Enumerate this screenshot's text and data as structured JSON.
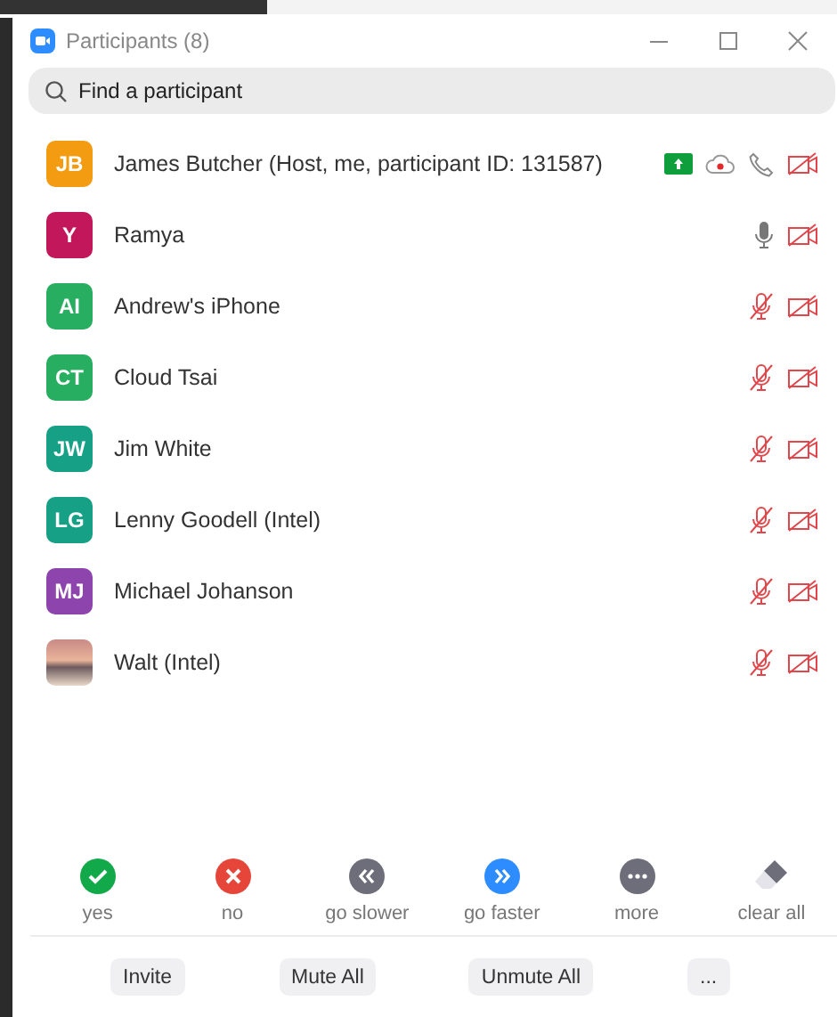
{
  "window": {
    "title": "Participants (8)"
  },
  "search": {
    "placeholder": "Find a participant"
  },
  "participants": [
    {
      "avatar": {
        "kind": "initials",
        "initials": "JB",
        "color": "#f39c12"
      },
      "name": "James Butcher (Host, me, participant ID: 131587)",
      "indicators": [
        {
          "kind": "screen-share"
        },
        {
          "kind": "recording"
        },
        {
          "kind": "phone"
        },
        {
          "kind": "video-off"
        }
      ]
    },
    {
      "avatar": {
        "kind": "initials",
        "initials": "Y",
        "color": "#c2185b"
      },
      "name": "Ramya",
      "indicators": [
        {
          "kind": "mic-on"
        },
        {
          "kind": "video-off"
        }
      ]
    },
    {
      "avatar": {
        "kind": "initials",
        "initials": "AI",
        "color": "#27ae60"
      },
      "name": "Andrew's iPhone",
      "indicators": [
        {
          "kind": "mic-muted"
        },
        {
          "kind": "video-off"
        }
      ]
    },
    {
      "avatar": {
        "kind": "initials",
        "initials": "CT",
        "color": "#27ae60"
      },
      "name": "Cloud Tsai",
      "indicators": [
        {
          "kind": "mic-muted"
        },
        {
          "kind": "video-off"
        }
      ]
    },
    {
      "avatar": {
        "kind": "initials",
        "initials": "JW",
        "color": "#16a085"
      },
      "name": "Jim White",
      "indicators": [
        {
          "kind": "mic-muted"
        },
        {
          "kind": "video-off"
        }
      ]
    },
    {
      "avatar": {
        "kind": "initials",
        "initials": "LG",
        "color": "#16a085"
      },
      "name": "Lenny Goodell (Intel)",
      "indicators": [
        {
          "kind": "mic-muted"
        },
        {
          "kind": "video-off"
        }
      ]
    },
    {
      "avatar": {
        "kind": "initials",
        "initials": "MJ",
        "color": "#8e44ad"
      },
      "name": "Michael Johanson",
      "indicators": [
        {
          "kind": "mic-muted"
        },
        {
          "kind": "video-off"
        }
      ]
    },
    {
      "avatar": {
        "kind": "photo"
      },
      "name": "Walt (Intel)",
      "indicators": [
        {
          "kind": "mic-muted"
        },
        {
          "kind": "video-off"
        }
      ]
    }
  ],
  "reactions": [
    {
      "kind": "yes",
      "label": "yes"
    },
    {
      "kind": "no",
      "label": "no"
    },
    {
      "kind": "slower",
      "label": "go slower"
    },
    {
      "kind": "faster",
      "label": "go faster"
    },
    {
      "kind": "more",
      "label": "more"
    },
    {
      "kind": "clear",
      "label": "clear all"
    }
  ],
  "buttons": [
    "Invite",
    "Mute All",
    "Unmute All",
    "..."
  ]
}
